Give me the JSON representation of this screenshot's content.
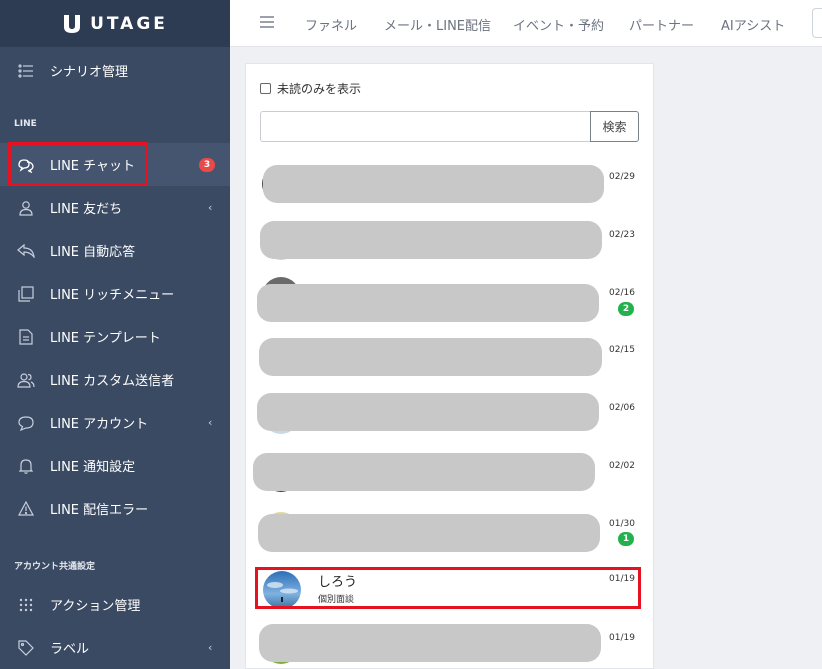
{
  "brand": {
    "name": "UTAGE"
  },
  "sidebar": {
    "scenario": {
      "label": "シナリオ管理",
      "icon": "list-icon"
    },
    "section_line": "LINE",
    "items": [
      {
        "label": "LINE チャット",
        "icon": "chat-bubbles-icon",
        "badge": "3"
      },
      {
        "label": "LINE 友だち",
        "icon": "user-icon"
      },
      {
        "label": "LINE 自動応答",
        "icon": "reply-icon"
      },
      {
        "label": "LINE リッチメニュー",
        "icon": "copy-icon"
      },
      {
        "label": "LINE テンプレート",
        "icon": "document-icon"
      },
      {
        "label": "LINE カスタム送信者",
        "icon": "users-icon"
      },
      {
        "label": "LINE アカウント",
        "icon": "chat-bubble-icon"
      },
      {
        "label": "LINE 通知設定",
        "icon": "bell-icon"
      },
      {
        "label": "LINE 配信エラー",
        "icon": "warning-icon"
      }
    ],
    "section_common": "アカウント共通設定",
    "common_items": [
      {
        "label": "アクション管理",
        "icon": "grid-dots-icon"
      },
      {
        "label": "ラベル",
        "icon": "tag-icon"
      }
    ]
  },
  "topnav": {
    "items": [
      "ファネル",
      "メール・LINE配信",
      "イベント・予約",
      "パートナー",
      "AIアシスト"
    ]
  },
  "chat_panel": {
    "unread_only_label": "未読のみを表示",
    "search_value": "",
    "search_button": "検索",
    "rows": [
      {
        "date": "02/29",
        "badge": ""
      },
      {
        "date": "02/23",
        "badge": ""
      },
      {
        "date": "02/16",
        "badge": "2"
      },
      {
        "date": "02/15",
        "badge": ""
      },
      {
        "date": "02/06",
        "badge": ""
      },
      {
        "date": "02/02",
        "badge": ""
      },
      {
        "date": "01/30",
        "badge": "1"
      },
      {
        "date": "01/19",
        "badge": "",
        "name": "しろう",
        "subtitle": "個別面談"
      },
      {
        "date": "01/19",
        "badge": ""
      }
    ]
  },
  "colors": {
    "sidebar_bg": "#3b4a63",
    "logo_bar_bg": "#2e3c53",
    "highlight": "#e6121f",
    "badge_red": "#e84a4a",
    "badge_green": "#22b14c"
  }
}
